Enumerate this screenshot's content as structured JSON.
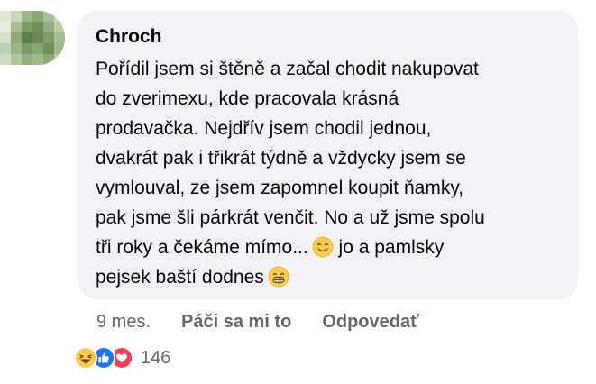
{
  "comment": {
    "author": "Chroch",
    "lines": [
      "Pořídil jsem si štěně a začal chodit nakupovat",
      "do zverimexu, kde pracovala krásná",
      "prodavačka. Nejdřív jsem chodil jednou,",
      "dvakrát pak i třikrát týdně a vždycky jsem se",
      "vymlouval, ze jsem zapomnel koupit ňamky,",
      "pak jsme šli párkrát venčit. No a už jsme spolu",
      "tři roky a čekáme mímo...",
      " jo a pamlsky",
      "pejsek baští dodnes"
    ],
    "emojis": [
      "smiling-face-emoji",
      "grinning-face-emoji"
    ]
  },
  "actions": {
    "time": "9 mes.",
    "like_label": "Páči sa mi to",
    "reply_label": "Odpovedať"
  },
  "reactions": {
    "icons": [
      "haha-reaction-icon",
      "like-reaction-icon",
      "love-reaction-icon"
    ],
    "count": "146"
  },
  "colors": {
    "bubble": "#f0f2f5",
    "secondary_text": "#65676b",
    "like_blue": "#1877f2",
    "love_red": "#f33e58",
    "emoji_yellow": "#ffcc4d"
  }
}
